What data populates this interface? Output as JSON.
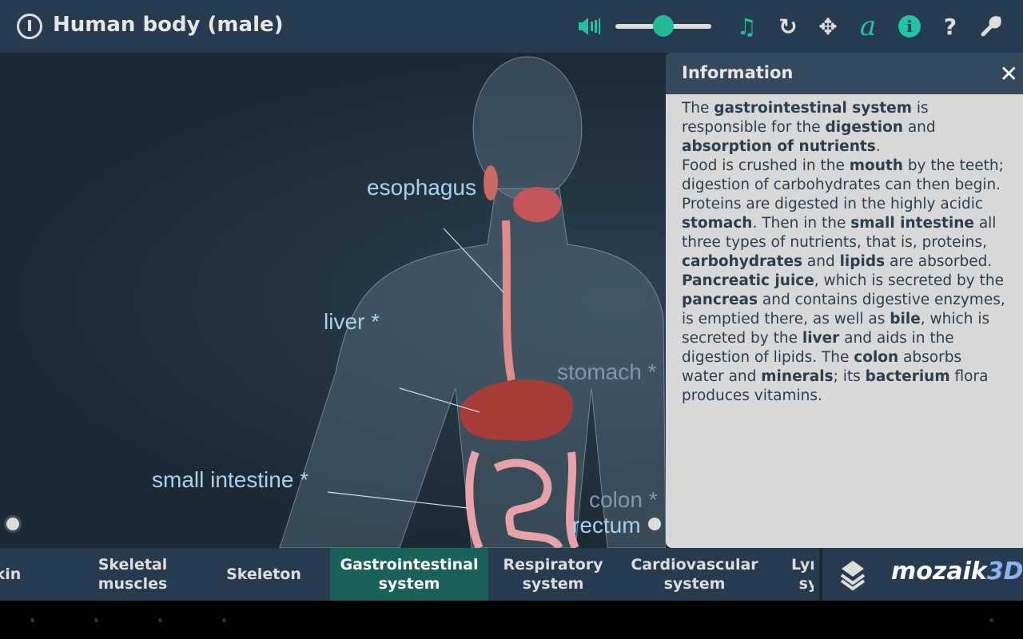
{
  "header": {
    "title": "Human body (male)",
    "volume_percent": 50
  },
  "toolbar": {
    "icons": [
      "power-icon",
      "speaker-icon",
      "music-icon",
      "reset-icon",
      "move-icon",
      "font-icon",
      "info-icon",
      "help-icon",
      "settings-icon"
    ],
    "music": "♫",
    "reset": "↻",
    "move": "✥",
    "font": "a",
    "info": "i",
    "help": "?",
    "settings": "🔧"
  },
  "labels": {
    "esophagus": "esophagus",
    "liver": "liver *",
    "stomach": "stomach *",
    "small_intestine": "small intestine *",
    "colon": "colon *",
    "rectum": "rectum"
  },
  "info": {
    "title": "Information",
    "close": "✕",
    "paragraphs": [
      [
        {
          "t": "The "
        },
        {
          "t": "gastrointestinal system",
          "b": true
        },
        {
          "t": " is responsible for the "
        },
        {
          "t": "digestion",
          "b": true
        },
        {
          "t": " and "
        },
        {
          "t": "absorption of nutrients",
          "b": true
        },
        {
          "t": "."
        }
      ],
      [
        {
          "t": "Food is crushed in the "
        },
        {
          "t": "mouth",
          "b": true
        },
        {
          "t": " by the teeth; digestion of carbohydrates can then begin. Proteins are digested in the highly acidic "
        },
        {
          "t": "stomach",
          "b": true
        },
        {
          "t": ". Then in the "
        },
        {
          "t": "small intestine",
          "b": true
        },
        {
          "t": " all three types of nutrients, that is, proteins, "
        },
        {
          "t": "carbohydrates",
          "b": true
        },
        {
          "t": " and "
        },
        {
          "t": "lipids",
          "b": true
        },
        {
          "t": " are absorbed."
        }
      ],
      [
        {
          "t": "Pancreatic juice",
          "b": true
        },
        {
          "t": ", which is secreted by the "
        },
        {
          "t": "pancreas",
          "b": true
        },
        {
          "t": " and contains digestive enzymes, is emptied there, as well as "
        },
        {
          "t": "bile",
          "b": true
        },
        {
          "t": ", which is secreted by the "
        },
        {
          "t": "liver",
          "b": true
        },
        {
          "t": " and aids in the digestion of lipids. The "
        },
        {
          "t": "colon",
          "b": true
        },
        {
          "t": " absorbs water and "
        },
        {
          "t": "minerals",
          "b": true
        },
        {
          "t": "; its "
        },
        {
          "t": "bacterium",
          "b": true
        },
        {
          "t": " flora produces vitamins."
        }
      ]
    ]
  },
  "tabs": [
    {
      "label": "kin"
    },
    {
      "label": "Skeletal muscles"
    },
    {
      "label": "Skeleton"
    },
    {
      "label": "Gastrointestinal system",
      "active": true
    },
    {
      "label": "Respiratory system"
    },
    {
      "label": "Cardiovascular system"
    },
    {
      "label": "Lym sy"
    }
  ],
  "brand": {
    "name": "mozaik",
    "suffix": "3D"
  },
  "colors": {
    "accent": "#20c4a4",
    "active_tab": "#1a6259",
    "bar": "#273b50"
  }
}
